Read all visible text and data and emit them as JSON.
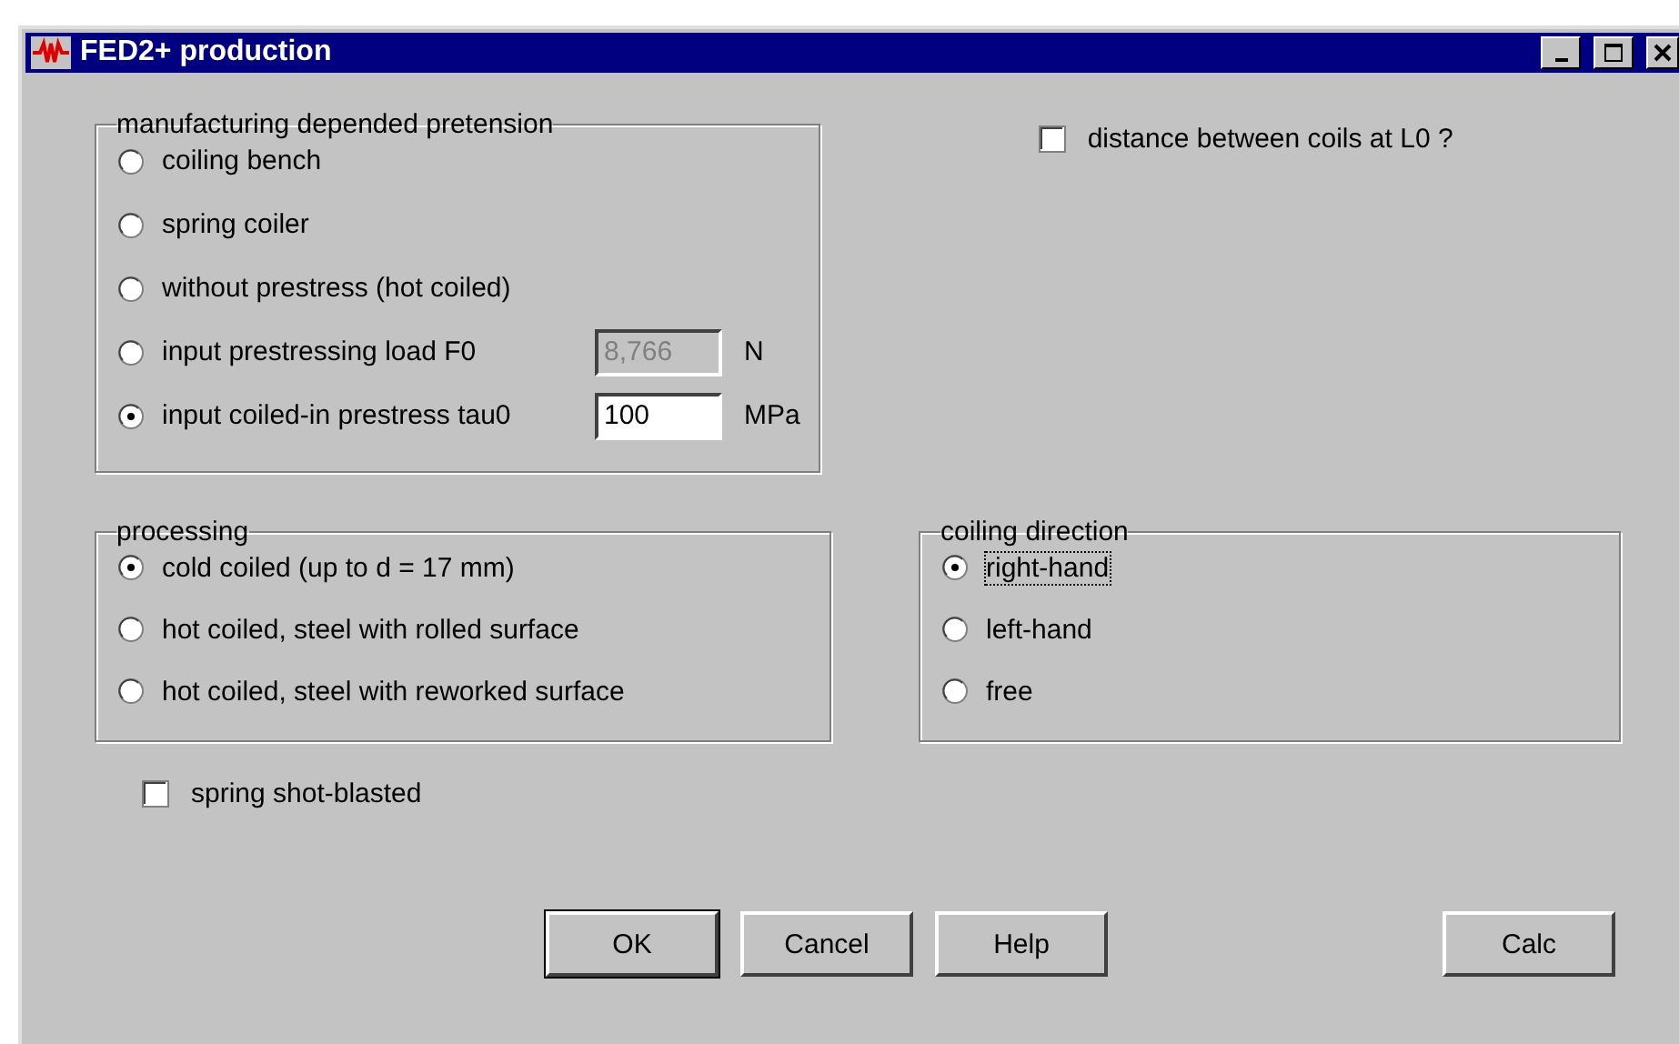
{
  "window": {
    "title": "FED2+ production"
  },
  "pretension": {
    "title": "manufacturing depended pretension",
    "options": [
      {
        "label": "coiling bench",
        "selected": false
      },
      {
        "label": "spring coiler",
        "selected": false
      },
      {
        "label": "without prestress (hot coiled)",
        "selected": false
      },
      {
        "label": "input prestressing load F0",
        "selected": false,
        "field": {
          "value": "8,766",
          "unit": "N",
          "disabled": true
        }
      },
      {
        "label": "input coiled-in prestress tau0",
        "selected": true,
        "field": {
          "value": "100",
          "unit": "MPa",
          "disabled": false
        }
      }
    ]
  },
  "distance_checkbox": {
    "label": "distance between coils at L0 ?",
    "checked": false
  },
  "processing": {
    "title": "processing",
    "options": [
      {
        "label": "cold coiled (up to d = 17 mm)",
        "selected": true
      },
      {
        "label": "hot coiled, steel with rolled surface",
        "selected": false
      },
      {
        "label": "hot coiled, steel with reworked surface",
        "selected": false
      }
    ]
  },
  "coiling_direction": {
    "title": "coiling direction",
    "options": [
      {
        "label": "right-hand",
        "selected": true,
        "focused": true
      },
      {
        "label": "left-hand",
        "selected": false,
        "focused": false
      },
      {
        "label": "free",
        "selected": false,
        "focused": false
      }
    ]
  },
  "shot_blasted": {
    "label": "spring shot-blasted",
    "checked": false
  },
  "buttons": [
    {
      "label": "OK",
      "default": true
    },
    {
      "label": "Cancel",
      "default": false
    },
    {
      "label": "Help",
      "default": false
    },
    {
      "label": "Calc",
      "default": false
    }
  ]
}
